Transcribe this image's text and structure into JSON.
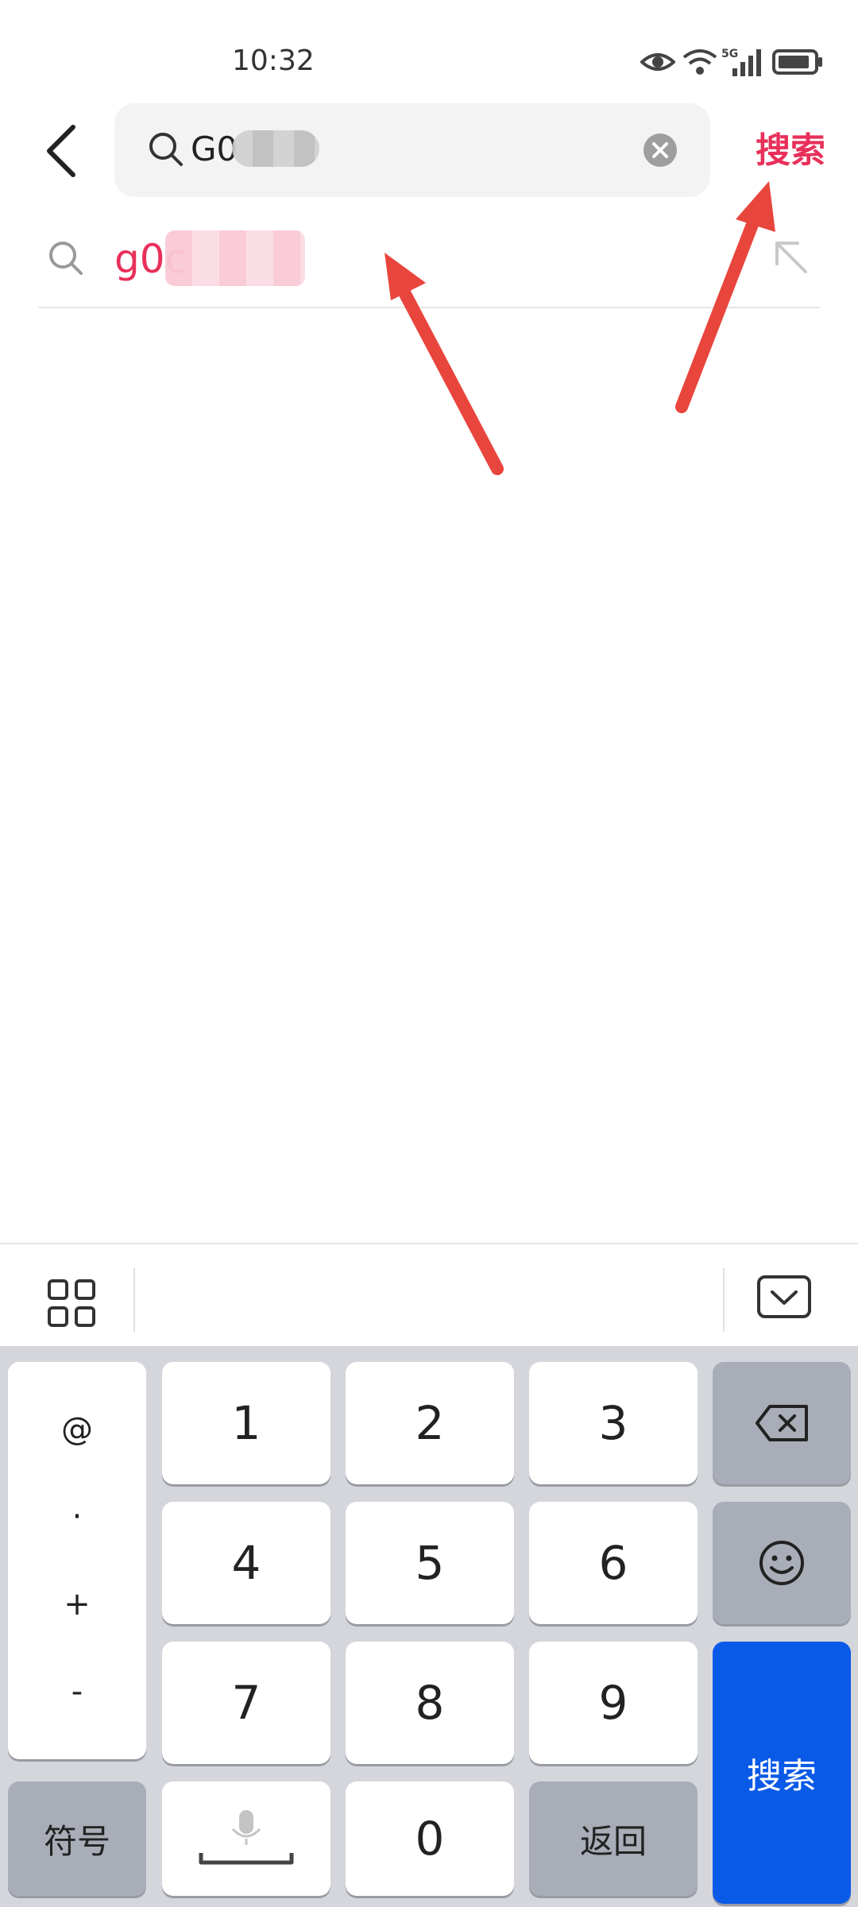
{
  "status_bar": {
    "time": "10:32",
    "network": "5G",
    "icons": [
      "eye-icon",
      "wifi-icon",
      "signal-icon",
      "battery-icon"
    ]
  },
  "header": {
    "search_query": "G0",
    "search_button": "搜索"
  },
  "suggestions": [
    {
      "text": "g0c"
    }
  ],
  "keyboard": {
    "toolbar": {
      "left_icon": "grid-menu-icon",
      "right_icon": "hide-keyboard-icon"
    },
    "side_symbols": [
      "@",
      "·",
      "+",
      "-"
    ],
    "digits": [
      "1",
      "2",
      "3",
      "4",
      "5",
      "6",
      "7",
      "8",
      "9",
      "0"
    ],
    "symbol_key": "符号",
    "return_key": "返回",
    "search_key": "搜索"
  },
  "colors": {
    "accent": "#e8305a",
    "enter_key": "#0a5ae8",
    "annotation_arrow": "#e8453c"
  }
}
